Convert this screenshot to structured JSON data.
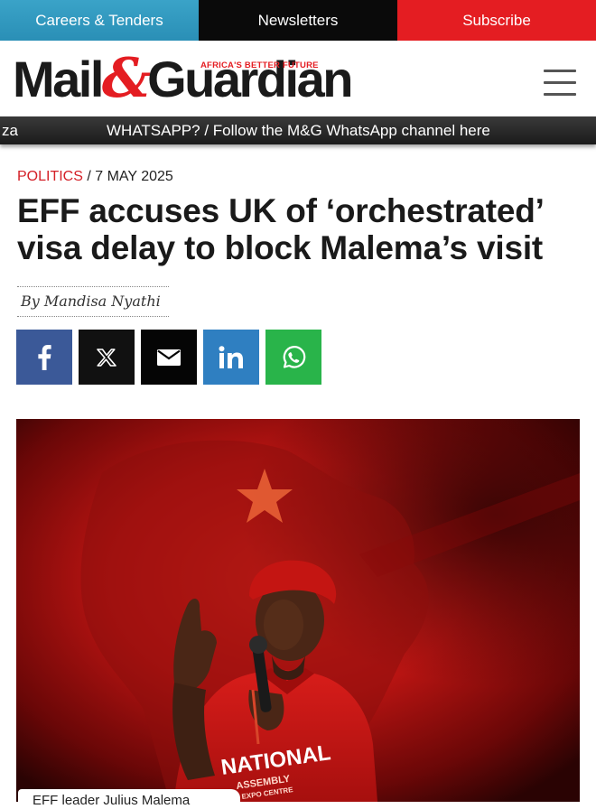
{
  "topnav": {
    "careers": "Careers & Tenders",
    "newsletters": "Newsletters",
    "subscribe": "Subscribe"
  },
  "header": {
    "logo_left": "Mail",
    "logo_amp": "&",
    "logo_right": "Guardian",
    "tagline": "AFRICA'S BETTER FUTURE",
    "menu_icon": "hamburger-menu-icon"
  },
  "ticker": {
    "left_fragment": "za",
    "message": "WHATSAPP? / Follow the M&G WhatsApp channel here"
  },
  "article": {
    "category": "POLITICS",
    "date": "/ 7 MAY 2025",
    "headline": "EFF accuses UK of ‘orchestrated’ visa delay to block Malema’s visit",
    "byline": "By Mandisa Nyathi"
  },
  "share": {
    "facebook_icon": "facebook-icon",
    "x_icon": "x-icon",
    "email_icon": "email-icon",
    "linkedin_icon": "linkedin-icon",
    "whatsapp_icon": "whatsapp-icon"
  },
  "photo": {
    "shirt_text": "NATIONAL",
    "shirt_text2": "ASSEMBLY",
    "shirt_text3": "EXPO CENTRE",
    "caption": "EFF leader Julius Malema"
  },
  "colors": {
    "brand_red": "#e41d22",
    "careers_blue": "#2a8fb6",
    "facebook": "#3b5998",
    "linkedin": "#2f7fc1",
    "whatsapp": "#29b44a"
  }
}
